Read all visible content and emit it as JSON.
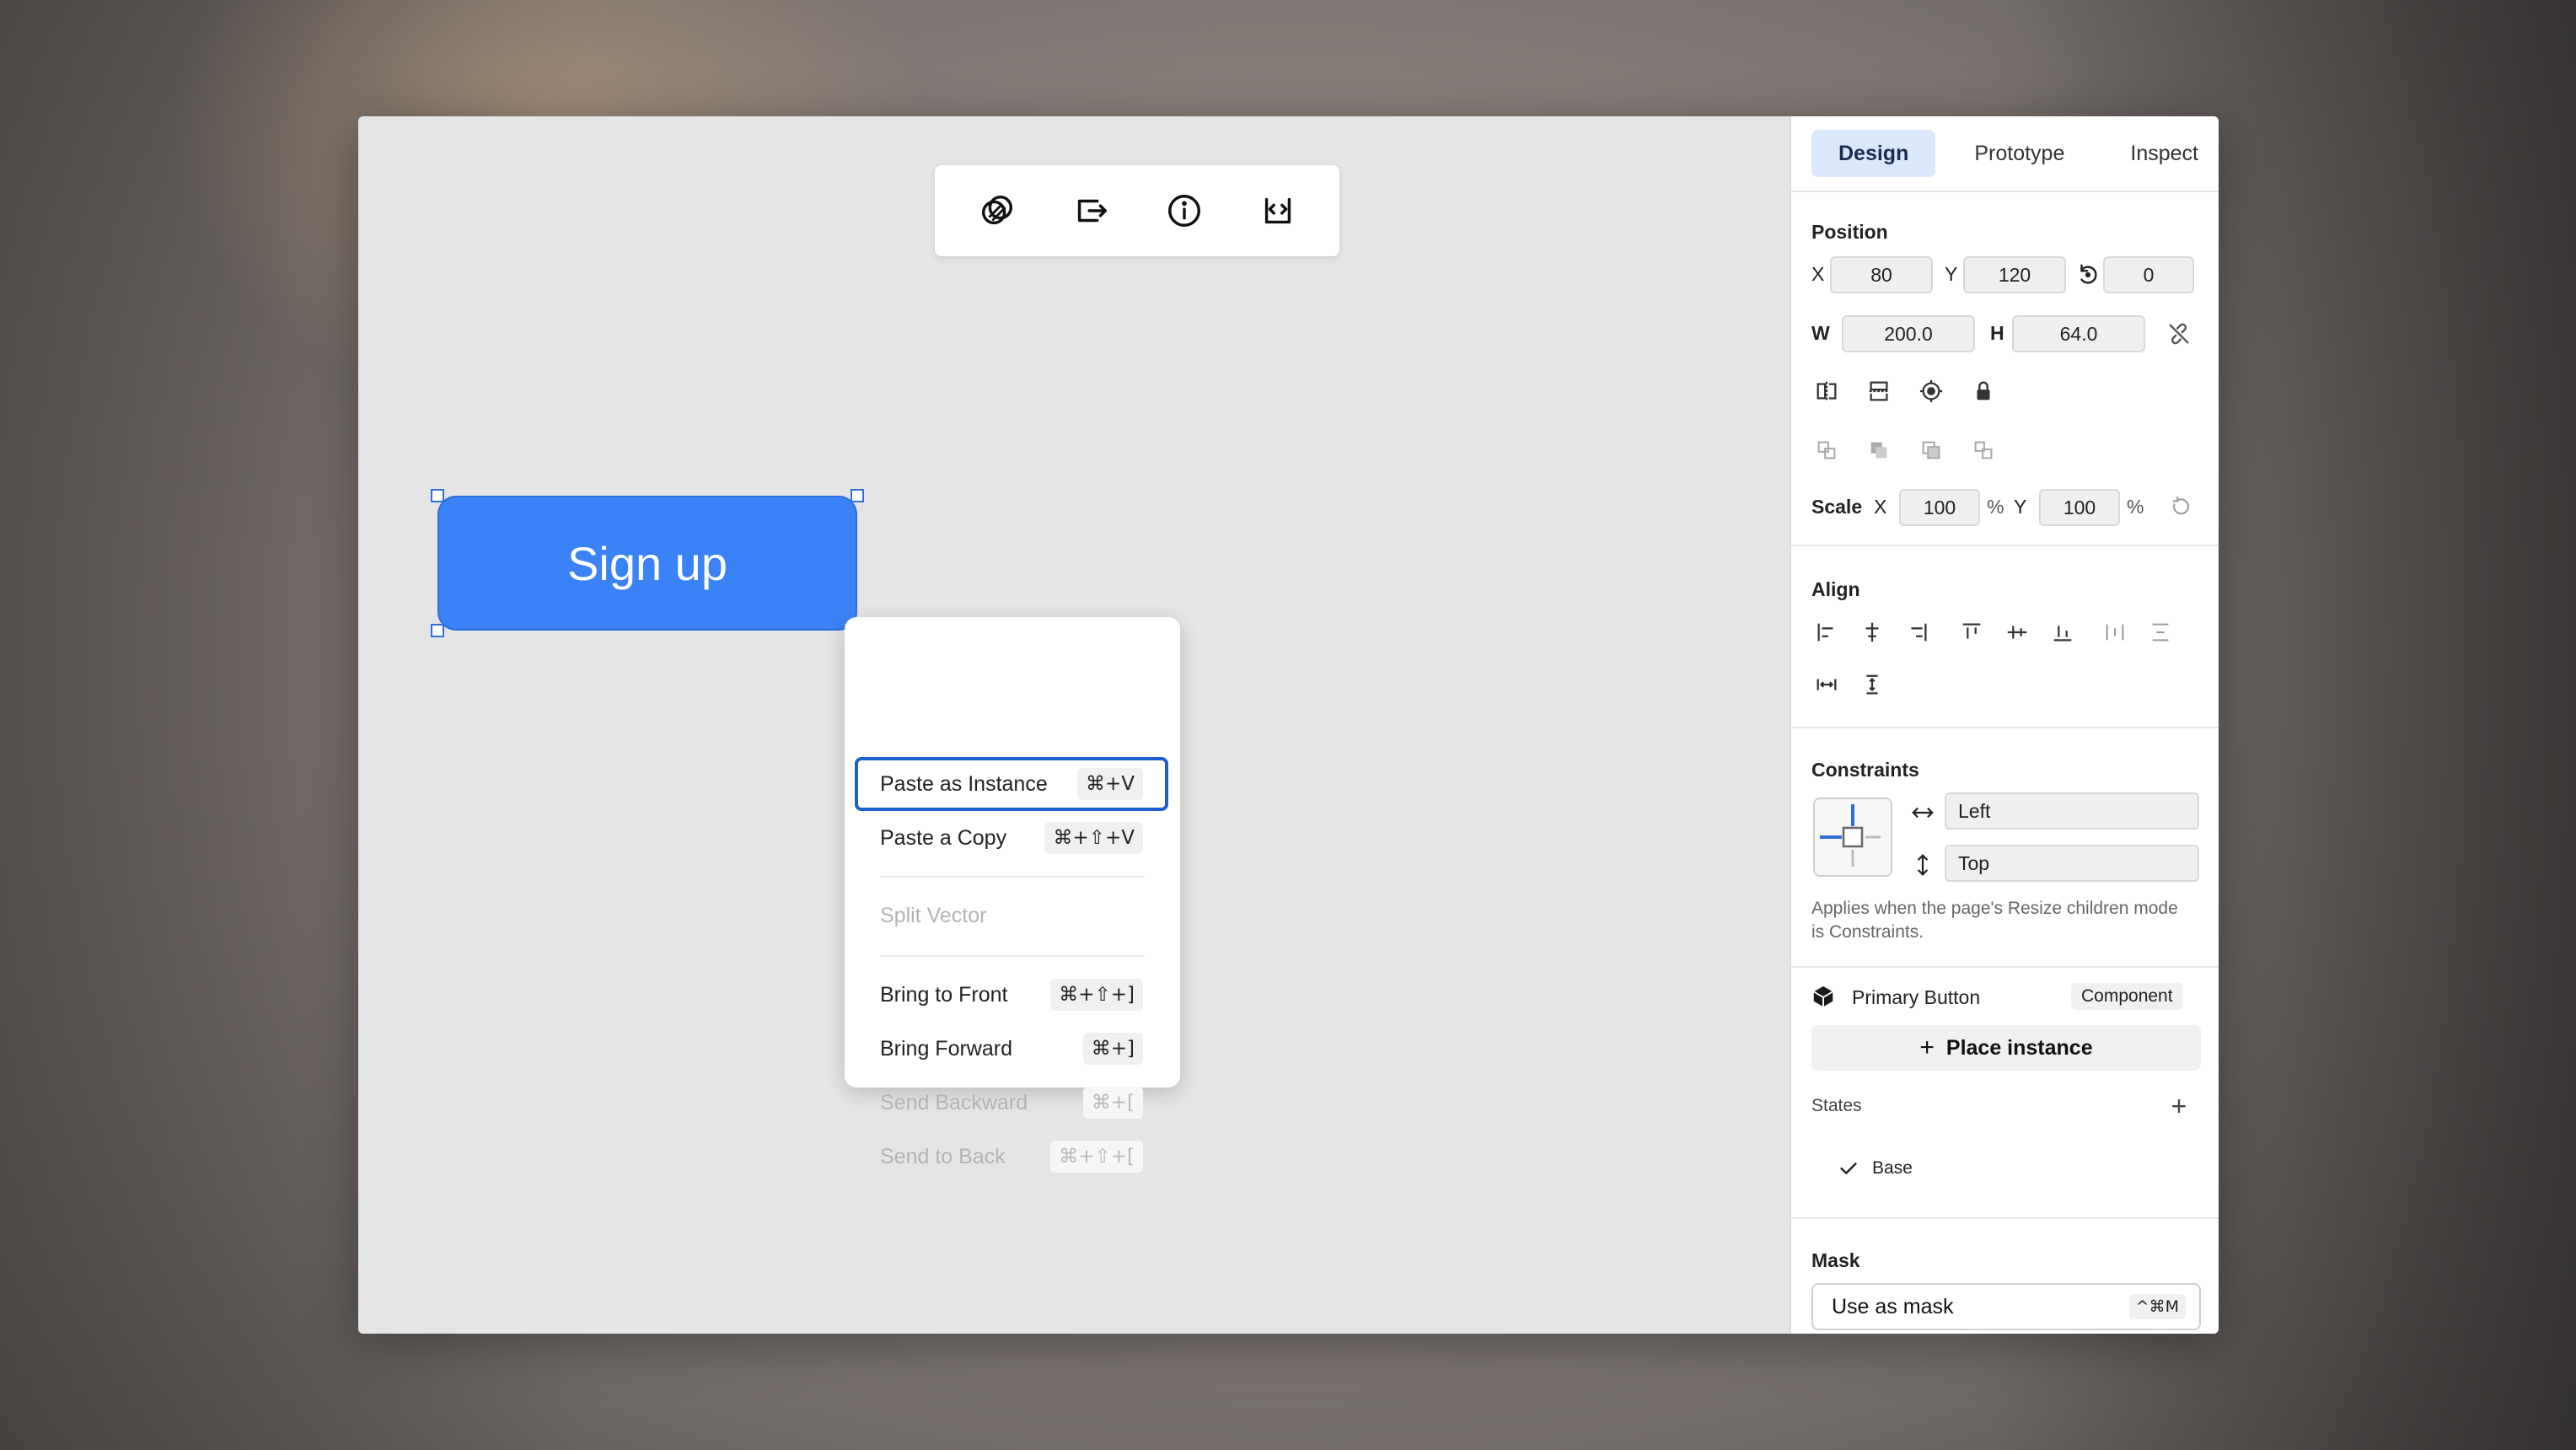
{
  "toolbar": {
    "icons": [
      "boolean-ops-icon",
      "export-icon",
      "info-icon",
      "code-icon"
    ]
  },
  "canvas": {
    "element_label": "Sign up",
    "element_color": "#3b82f6"
  },
  "context_menu": {
    "items": [
      {
        "label": "Paste as Instance",
        "shortcut": "⌘+V",
        "state": "active"
      },
      {
        "label": "Paste a Copy",
        "shortcut": "⌘+⇧+V",
        "state": "enabled"
      },
      {
        "label": "Split Vector",
        "shortcut": "",
        "state": "disabled"
      },
      {
        "label": "Bring to Front",
        "shortcut": "⌘+⇧+]",
        "state": "enabled"
      },
      {
        "label": "Bring Forward",
        "shortcut": "⌘+]",
        "state": "enabled"
      },
      {
        "label": "Send Backward",
        "shortcut": "⌘+[",
        "state": "disabled"
      },
      {
        "label": "Send to Back",
        "shortcut": "⌘+⇧+[",
        "state": "disabled"
      }
    ]
  },
  "panel": {
    "tabs": [
      "Design",
      "Prototype",
      "Inspect"
    ],
    "active_tab": "Design",
    "position": {
      "title": "Position",
      "x_label": "X",
      "x": "80",
      "y_label": "Y",
      "y": "120",
      "rotation": "0",
      "w_label": "W",
      "w": "200.0",
      "h_label": "H",
      "h": "64.0",
      "scale_label": "Scale",
      "scale_x_label": "X",
      "scale_x": "100",
      "scale_x_unit": "%",
      "scale_y_label": "Y",
      "scale_y": "100",
      "scale_y_unit": "%"
    },
    "align": {
      "title": "Align"
    },
    "constraints": {
      "title": "Constraints",
      "horizontal": "Left",
      "vertical": "Top",
      "note": "Applies when the page's Resize children mode is Constraints."
    },
    "component": {
      "name": "Primary Button",
      "badge": "Component",
      "place_label": "Place instance",
      "states_label": "States",
      "states": [
        "Base"
      ]
    },
    "mask": {
      "title": "Mask",
      "button_label": "Use as mask",
      "shortcut": "^⌘M"
    }
  },
  "colors": {
    "accent": "#3b82f6",
    "active_tab_bg": "#dbe7fb",
    "focus_border": "#1b5fd0"
  }
}
